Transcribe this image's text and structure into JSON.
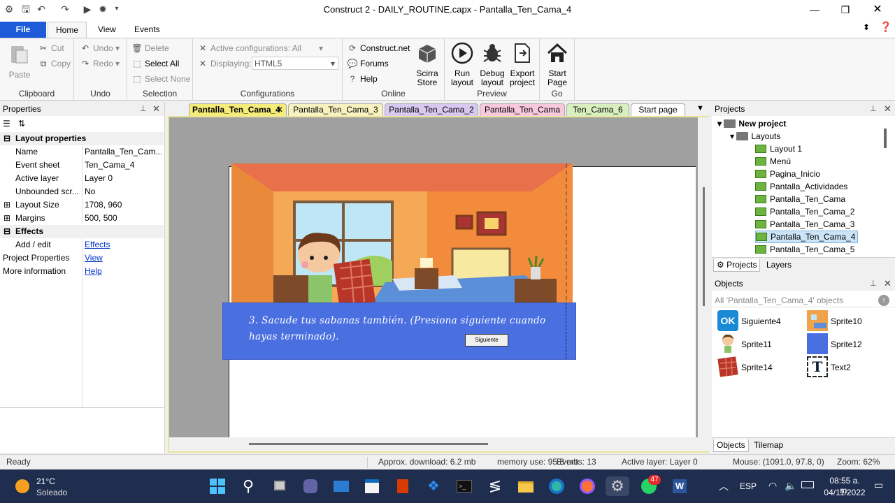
{
  "window": {
    "title": "Construct 2 - DAILY_ROUTINE.capx - Pantalla_Ten_Cama_4"
  },
  "ribbon_tabs": {
    "file": "File",
    "home": "Home",
    "view": "View",
    "events": "Events"
  },
  "clipboard": {
    "paste": "Paste",
    "cut": "Cut",
    "copy": "Copy",
    "label": "Clipboard"
  },
  "undo": {
    "undo": "Undo",
    "redo": "Redo",
    "label": "Undo"
  },
  "selection": {
    "delete": "Delete",
    "select_all": "Select All",
    "select_none": "Select None",
    "label": "Selection"
  },
  "configurations": {
    "active": "Active configurations: All",
    "displaying": "Displaying:",
    "displaying_value": "HTML5",
    "label": "Configurations"
  },
  "online": {
    "construct": "Construct.net",
    "forums": "Forums",
    "help": "Help",
    "store_l1": "Scirra",
    "store_l2": "Store",
    "label": "Online"
  },
  "preview": {
    "run_l1": "Run",
    "run_l2": "layout",
    "debug_l1": "Debug",
    "debug_l2": "layout",
    "export_l1": "Export",
    "export_l2": "project",
    "label": "Preview"
  },
  "go": {
    "start_l1": "Start",
    "start_l2": "Page",
    "label": "Go"
  },
  "properties": {
    "title": "Properties",
    "section_layout": "Layout properties",
    "rows": [
      {
        "k": "Name",
        "v": "Pantalla_Ten_Cam..."
      },
      {
        "k": "Event sheet",
        "v": "Ten_Cama_4"
      },
      {
        "k": "Active layer",
        "v": "Layer 0"
      },
      {
        "k": "Unbounded scr...",
        "v": "No"
      },
      {
        "k": "Layout Size",
        "v": "1708, 960"
      },
      {
        "k": "Margins",
        "v": "500, 500"
      }
    ],
    "section_effects": "Effects",
    "effects_k": "Add / edit",
    "effects_v": "Effects",
    "project_k": "Project Properties",
    "project_v": "View",
    "info_k": "More information",
    "info_v": "Help"
  },
  "doc_tabs": [
    {
      "label": "Pantalla_Ten_Cama_4",
      "color": "#f5ec7a"
    },
    {
      "label": "Pantalla_Ten_Cama_3",
      "color": "#f8f2c0"
    },
    {
      "label": "Pantalla_Ten_Cama_2",
      "color": "#d9c8f0"
    },
    {
      "label": "Pantalla_Ten_Cama",
      "color": "#f8c8dc"
    },
    {
      "label": "Ten_Cama_6",
      "color": "#d8f0c0"
    },
    {
      "label": "Start page",
      "color": "#ffffff"
    }
  ],
  "canvas": {
    "caption": "3. Sacude tus sabanas también. (Presiona siguiente cuando hayas terminado).",
    "button": "Siguiente"
  },
  "projects": {
    "title": "Projects",
    "root": "New project",
    "folder": "Layouts",
    "layouts": [
      "Layout 1",
      "Menú",
      "Pagina_Inicio",
      "Pantalla_Actividades",
      "Pantalla_Ten_Cama",
      "Pantalla_Ten_Cama_2",
      "Pantalla_Ten_Cama_3",
      "Pantalla_Ten_Cama_4",
      "Pantalla_Ten_Cama_5"
    ],
    "tab_projects": "Projects",
    "tab_layers": "Layers"
  },
  "objects": {
    "title": "Objects",
    "filter": "All 'Pantalla_Ten_Cama_4' objects",
    "items": [
      "Siguiente4",
      "Sprite10",
      "Sprite11",
      "Sprite12",
      "Sprite14",
      "Text2"
    ],
    "tab_objects": "Objects",
    "tab_tilemap": "Tilemap"
  },
  "status": {
    "ready": "Ready",
    "download": "Approx. download: 6.2 mb",
    "memory": "memory use: 95.8 mb",
    "events": "Events: 13",
    "layer": "Active layer: Layer 0",
    "mouse": "Mouse: (1091.0, 97.8, 0)",
    "zoom": "Zoom: 62%"
  },
  "taskbar": {
    "temp": "21°C",
    "weather": "Soleado",
    "lang": "ESP",
    "time": "08:55 a. m.",
    "date": "04/11/2022",
    "whatsapp_badge": "47"
  },
  "colors": {
    "accent": "#1d5bd8",
    "caption_bg": "#4a6fe0",
    "taskbar": "#1f2d4e"
  }
}
